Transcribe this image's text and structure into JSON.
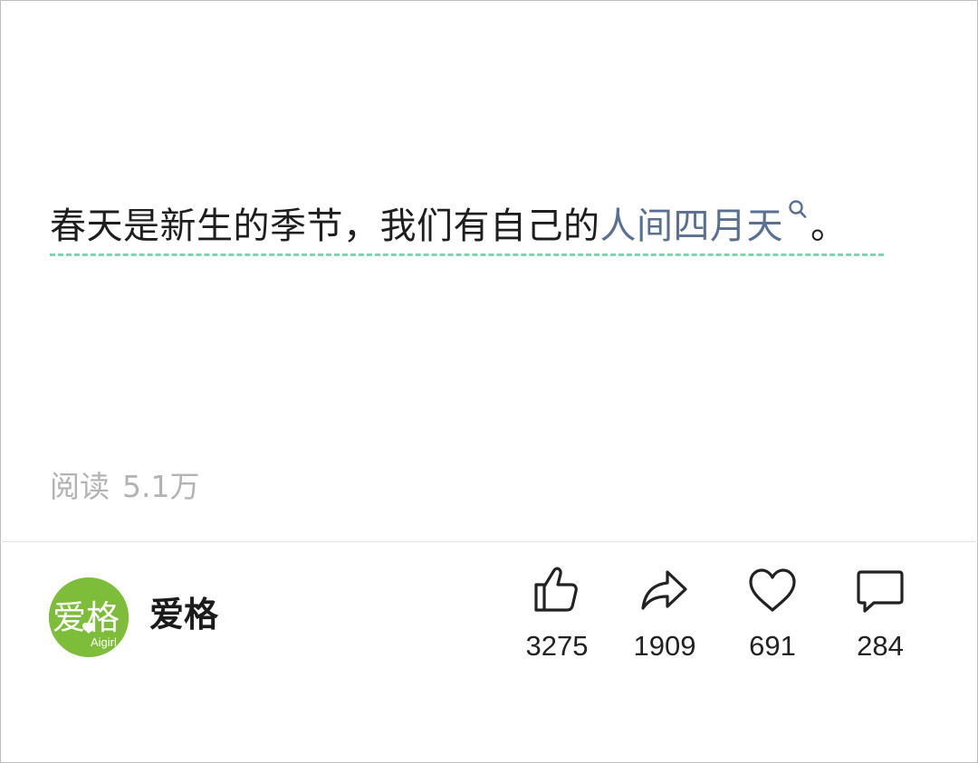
{
  "post": {
    "text_before": "春天是新生的季节，我们有自己的",
    "topic_link": "人间四月天",
    "text_after": "。",
    "read_label": "阅读",
    "read_count": "5.1万"
  },
  "author": {
    "name": "爱格",
    "avatar_main_text": "爱格",
    "avatar_sub_text": "Aigirl",
    "avatar_color": "#7dbd3a"
  },
  "actions": [
    {
      "icon": "thumbs-up-icon",
      "count": "3275"
    },
    {
      "icon": "share-arrow-icon",
      "count": "1909"
    },
    {
      "icon": "heart-icon",
      "count": "691"
    },
    {
      "icon": "comment-bubble-icon",
      "count": "284"
    }
  ],
  "colors": {
    "link": "#5a7093",
    "dashed_underline": "#7fd5ae",
    "muted_text": "#b3b3b3"
  }
}
